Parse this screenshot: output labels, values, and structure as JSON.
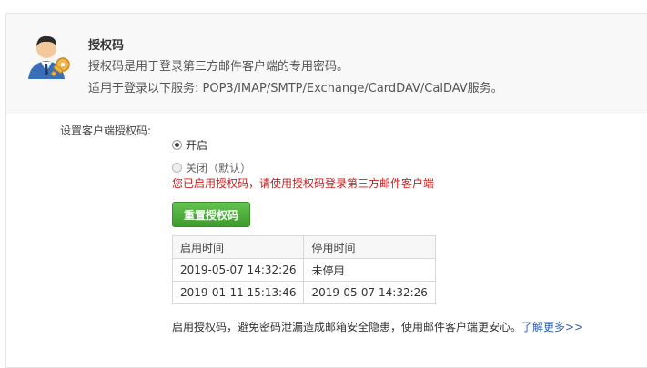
{
  "header": {
    "title": "授权码",
    "line1": "授权码是用于登录第三方邮件客户端的专用密码。",
    "line2": "适用于登录以下服务: POP3/IMAP/SMTP/Exchange/CardDAV/CalDAV服务。"
  },
  "settings": {
    "label": "设置客户端授权码:",
    "options": [
      {
        "label": "开启",
        "checked": true
      },
      {
        "label": "关闭（默认）",
        "checked": false
      }
    ],
    "status_text": "您已启用授权码，请使用授权码登录第三方邮件客户端",
    "reset_button": "重置授权码"
  },
  "history": {
    "columns": [
      "启用时间",
      "停用时间"
    ],
    "rows": [
      [
        "2019-05-07 14:32:26",
        "未停用"
      ],
      [
        "2019-01-11 15:13:46",
        "2019-05-07 14:32:26"
      ]
    ]
  },
  "footer": {
    "note": "启用授权码，避免密码泄漏造成邮箱安全隐患，使用邮件客户端更安心。",
    "link": "了解更多>>"
  },
  "colors": {
    "accent_green": "#4caf3a",
    "status_red": "#c81e1e",
    "link_blue": "#2a5db0"
  }
}
